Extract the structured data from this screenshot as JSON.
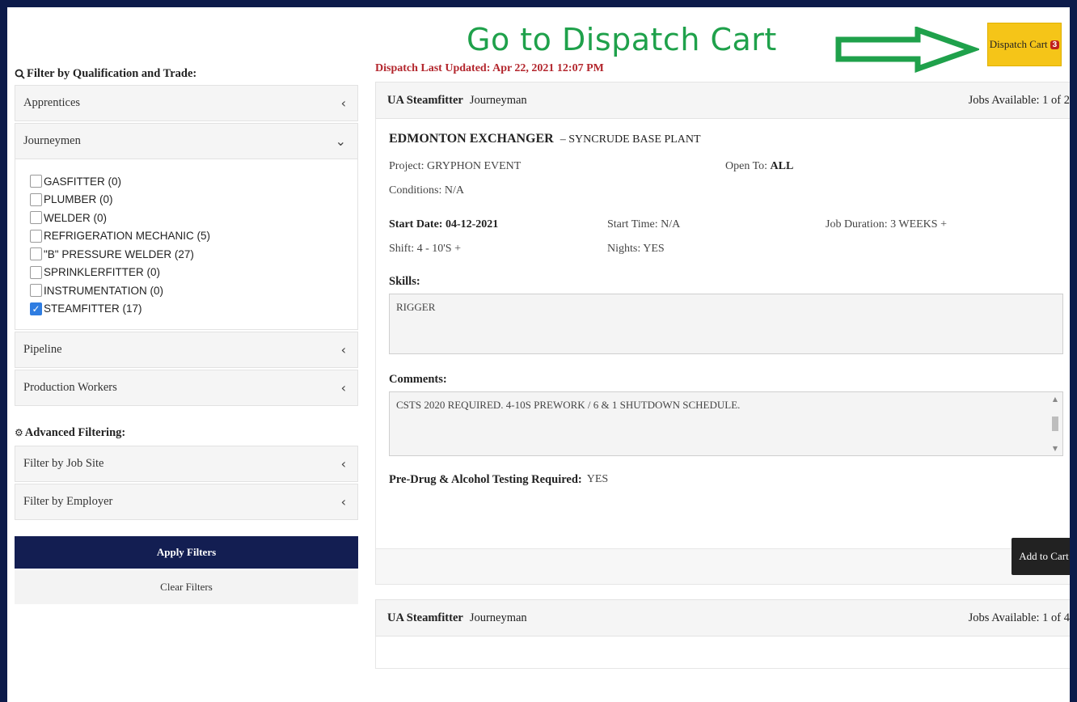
{
  "annotation": {
    "text": "Go to Dispatch Cart"
  },
  "header": {
    "cart_label": "Dispatch Cart",
    "cart_count": "3"
  },
  "sidebar": {
    "filter_heading": "Filter by Qualification and Trade:",
    "groups": [
      {
        "label": "Apprentices"
      },
      {
        "label": "Journeymen"
      },
      {
        "label": "Pipeline"
      },
      {
        "label": "Production Workers"
      }
    ],
    "journeymen_trades": [
      {
        "label": "GASFITTER (0)",
        "checked": false
      },
      {
        "label": "PLUMBER (0)",
        "checked": false
      },
      {
        "label": "WELDER (0)",
        "checked": false
      },
      {
        "label": "REFRIGERATION MECHANIC (5)",
        "checked": false
      },
      {
        "label": "\"B\" PRESSURE WELDER (27)",
        "checked": false
      },
      {
        "label": "SPRINKLERFITTER (0)",
        "checked": false
      },
      {
        "label": "INSTRUMENTATION (0)",
        "checked": false
      },
      {
        "label": "STEAMFITTER (17)",
        "checked": true
      }
    ],
    "advanced_heading": "Advanced Filtering:",
    "advanced_groups": [
      {
        "label": "Filter by Job Site"
      },
      {
        "label": "Filter by Employer"
      }
    ],
    "apply_label": "Apply Filters",
    "clear_label": "Clear Filters"
  },
  "main": {
    "updated": "Dispatch Last Updated: Apr 22, 2021 12:07 PM",
    "jobs": [
      {
        "trade": "UA Steamfitter",
        "level": "Journeyman",
        "available": "Jobs Available: 1 of 2",
        "employer": "EDMONTON EXCHANGER",
        "site": "– SYNCRUDE BASE PLANT",
        "project": "Project: GRYPHON EVENT",
        "open_to_label": "Open To:",
        "open_to_value": "ALL",
        "conditions": "Conditions: N/A",
        "start_date": "Start Date: 04-12-2021",
        "start_time": "Start Time: N/A",
        "duration": "Job Duration: 3 WEEKS +",
        "shift": "Shift: 4 - 10'S +",
        "nights": "Nights: YES",
        "skills_label": "Skills:",
        "skills": "RIGGER",
        "comments_label": "Comments:",
        "comments": "CSTS 2020 REQUIRED.  4-10S PREWORK / 6 & 1 SHUTDOWN SCHEDULE.",
        "drug_label": "Pre-Drug & Alcohol Testing Required:",
        "drug_value": "YES",
        "add_label": "Add to Cart"
      },
      {
        "trade": "UA Steamfitter",
        "level": "Journeyman",
        "available": "Jobs Available: 1 of 4"
      }
    ]
  },
  "colors": {
    "navy": "#131e52",
    "accent_yellow": "#f5c518",
    "annotation_green": "#1fa14b",
    "updated_red": "#b3262d"
  },
  "icons": {
    "filter": "search-icon",
    "advanced": "gear-icon",
    "collapsed": "chevron-left-icon",
    "expanded": "chevron-down-icon"
  }
}
